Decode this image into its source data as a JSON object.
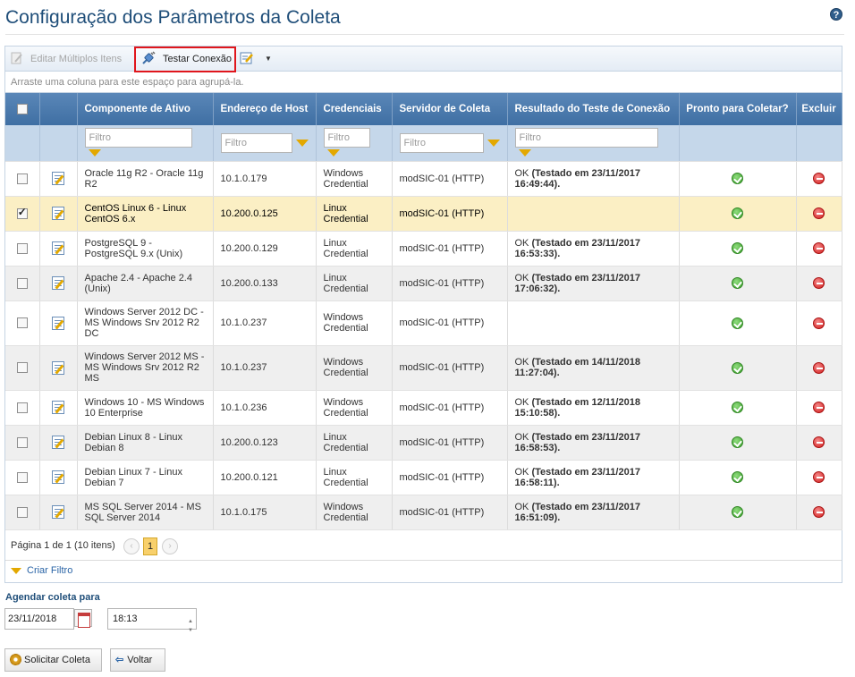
{
  "page": {
    "title": "Configuração dos Parâmetros da Coleta",
    "help_icon": "?"
  },
  "toolbar": {
    "edit_multiple_label": "Editar Múltiplos Itens",
    "test_connection_label": "Testar Conexão",
    "dropdown_glyph": "▼"
  },
  "group_hint": "Arraste uma coluna para este espaço para agrupá-la.",
  "columns": {
    "asset": "Componente de Ativo",
    "host": "Endereço de Host",
    "credentials": "Credenciais",
    "server": "Servidor de Coleta",
    "result": "Resultado do Teste de Conexão",
    "ready": "Pronto para Coletar?",
    "delete": "Excluir"
  },
  "filter_placeholder": "Filtro",
  "rows": [
    {
      "asset": "Oracle 11g R2 - Oracle 11g R2",
      "host": "10.1.0.179",
      "cred": "Windows Credential",
      "server": "modSIC-01 (HTTP)",
      "res_ok": "OK",
      "res_detail": "(Testado em 23/11/2017 16:49:44).",
      "checked": false
    },
    {
      "asset": "CentOS Linux 6 - Linux CentOS 6.x",
      "host": "10.200.0.125",
      "cred": "Linux Credential",
      "server": "modSIC-01 (HTTP)",
      "res_ok": "",
      "res_detail": "",
      "checked": true
    },
    {
      "asset": "PostgreSQL 9 - PostgreSQL 9.x (Unix)",
      "host": "10.200.0.129",
      "cred": "Linux Credential",
      "server": "modSIC-01 (HTTP)",
      "res_ok": "OK",
      "res_detail": "(Testado em 23/11/2017 16:53:33).",
      "checked": false
    },
    {
      "asset": "Apache 2.4 - Apache 2.4 (Unix)",
      "host": "10.200.0.133",
      "cred": "Linux Credential",
      "server": "modSIC-01 (HTTP)",
      "res_ok": "OK",
      "res_detail": "(Testado em 23/11/2017 17:06:32).",
      "checked": false
    },
    {
      "asset": "Windows Server 2012 DC - MS Windows Srv 2012 R2 DC",
      "host": "10.1.0.237",
      "cred": "Windows Credential",
      "server": "modSIC-01 (HTTP)",
      "res_ok": "",
      "res_detail": "",
      "checked": false
    },
    {
      "asset": "Windows Server 2012 MS - MS Windows Srv 2012 R2 MS",
      "host": "10.1.0.237",
      "cred": "Windows Credential",
      "server": "modSIC-01 (HTTP)",
      "res_ok": "OK",
      "res_detail": "(Testado em 14/11/2018 11:27:04).",
      "checked": false
    },
    {
      "asset": "Windows 10 - MS Windows 10 Enterprise",
      "host": "10.1.0.236",
      "cred": "Windows Credential",
      "server": "modSIC-01 (HTTP)",
      "res_ok": "OK",
      "res_detail": "(Testado em 12/11/2018 15:10:58).",
      "checked": false
    },
    {
      "asset": "Debian Linux 8 - Linux Debian 8",
      "host": "10.200.0.123",
      "cred": "Linux Credential",
      "server": "modSIC-01 (HTTP)",
      "res_ok": "OK",
      "res_detail": "(Testado em 23/11/2017 16:58:53).",
      "checked": false
    },
    {
      "asset": "Debian Linux 7 - Linux Debian 7",
      "host": "10.200.0.121",
      "cred": "Linux Credential",
      "server": "modSIC-01 (HTTP)",
      "res_ok": "OK",
      "res_detail": "(Testado em 23/11/2017 16:58:11).",
      "checked": false
    },
    {
      "asset": "MS SQL Server 2014 - MS SQL Server 2014",
      "host": "10.1.0.175",
      "cred": "Windows Credential",
      "server": "modSIC-01 (HTTP)",
      "res_ok": "OK",
      "res_detail": "(Testado em 23/11/2017 16:51:09).",
      "checked": false
    }
  ],
  "pager": {
    "text": "Página 1 de 1 (10 itens)",
    "prev": "‹",
    "next": "›",
    "current": "1"
  },
  "create_filter_label": "Criar Filtro",
  "schedule": {
    "label": "Agendar coleta para",
    "date": "23/11/2018",
    "time": "18:13"
  },
  "buttons": {
    "collect": "Solicitar Coleta",
    "back": "Voltar"
  },
  "colors": {
    "title": "#1f4e79",
    "header": "#4a79ad",
    "selected_row": "#fbefc4",
    "highlight_border": "#e0161c"
  }
}
